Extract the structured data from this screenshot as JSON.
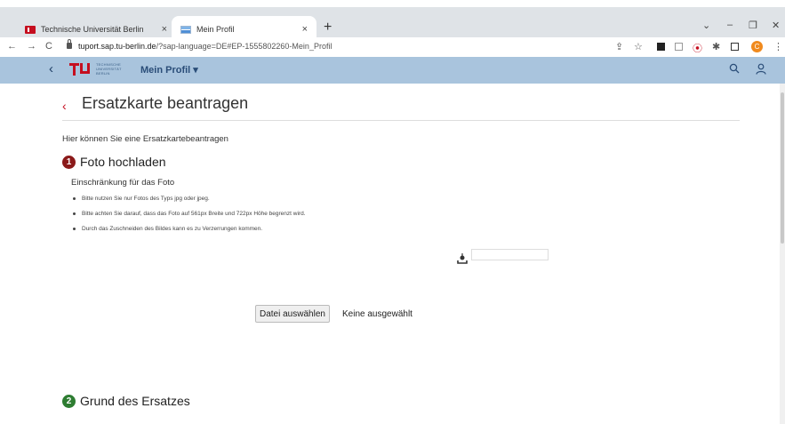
{
  "browser": {
    "tabs": [
      {
        "label": "Technische Universität Berlin",
        "close": "×"
      },
      {
        "label": "Mein Profil",
        "close": "×"
      }
    ],
    "new_tab": "+",
    "window_controls": {
      "dropdown": "⌄",
      "minimize": "–",
      "restore": "❐",
      "close": "✕"
    },
    "nav": {
      "back": "←",
      "forward": "→",
      "reload": "C"
    },
    "url_host": "tuport.sap.tu-berlin.de",
    "url_path": "/?sap-language=DE#EP-1555802260-Mein_Profil",
    "profile_initial": "C"
  },
  "app_header": {
    "back": "‹",
    "logo_text": "TECHNISCHE UNIVERSITÄT BERLIN",
    "title": "Mein Profil ▾",
    "search_icon": "search-icon",
    "user_icon": "user-icon"
  },
  "page": {
    "back": "‹",
    "title": "Ersatzkarte beantragen",
    "intro": "Hier können Sie eine Ersatzkartebeantragen",
    "step1": {
      "num": "1",
      "label": "Foto hochladen",
      "color": "#8b1a1a"
    },
    "subhead": "Einschränkung für das Foto",
    "rules": [
      "Bitte nutzen Sie nur Fotos des Typs jpg oder jpeg.",
      "Bitte achten Sie darauf, dass das Foto auf 561px Breite und 722px Höhe begrenzt wird.",
      "Durch das Zuschneiden des Bildes kann es zu Verzerrungen kommen."
    ],
    "file_button": "Datei auswählen",
    "file_status": "Keine ausgewählt",
    "step2": {
      "num": "2",
      "label": "Grund des Ersatzes",
      "color": "#2e7d32"
    }
  }
}
